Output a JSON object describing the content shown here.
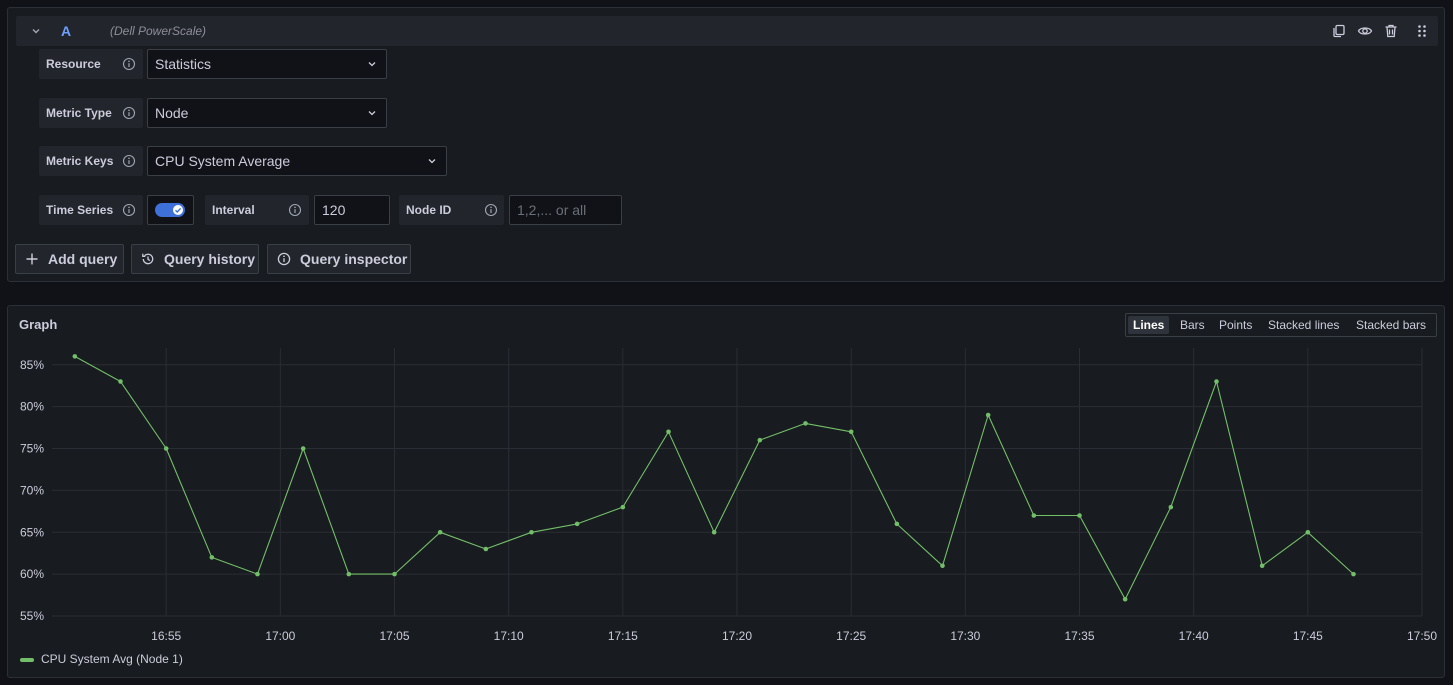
{
  "query": {
    "letter": "A",
    "datasource": "(Dell PowerScale)",
    "header_icons": [
      "collapse-chevron-icon",
      "duplicate-icon",
      "eye-icon",
      "trash-icon",
      "drag-handle-icon"
    ],
    "resource": {
      "label": "Resource",
      "value": "Statistics"
    },
    "metric_type": {
      "label": "Metric Type",
      "value": "Node"
    },
    "metric_keys": {
      "label": "Metric Keys",
      "value": "CPU System Average"
    },
    "time_series": {
      "label": "Time Series",
      "enabled": true
    },
    "interval": {
      "label": "Interval",
      "value": "120"
    },
    "node_id": {
      "label": "Node ID",
      "value": "",
      "placeholder": "1,2,... or all"
    }
  },
  "actions": {
    "add_query": "Add query",
    "query_history": "Query history",
    "query_inspector": "Query inspector"
  },
  "graph": {
    "title": "Graph",
    "view_modes": [
      "Lines",
      "Bars",
      "Points",
      "Stacked lines",
      "Stacked bars"
    ],
    "active_mode": "Lines"
  },
  "chart_data": {
    "type": "line",
    "title": "Graph",
    "xlabel": "",
    "ylabel": "",
    "x_ticks": [
      "16:55",
      "17:00",
      "17:05",
      "17:10",
      "17:15",
      "17:20",
      "17:25",
      "17:30",
      "17:35",
      "17:40",
      "17:45",
      "17:50"
    ],
    "y_ticks": [
      "55%",
      "60%",
      "65%",
      "70%",
      "75%",
      "80%",
      "85%"
    ],
    "ylim": [
      55,
      87
    ],
    "grid": true,
    "legend_position": "bottom-left",
    "series": [
      {
        "name": "CPU System Avg (Node 1)",
        "color": "#73bf69",
        "x": [
          "16:51",
          "16:53",
          "16:55",
          "16:57",
          "16:59",
          "17:01",
          "17:03",
          "17:05",
          "17:07",
          "17:09",
          "17:11",
          "17:13",
          "17:15",
          "17:17",
          "17:19",
          "17:21",
          "17:23",
          "17:25",
          "17:27",
          "17:29",
          "17:31",
          "17:33",
          "17:35",
          "17:37",
          "17:39",
          "17:41",
          "17:43",
          "17:45",
          "17:47"
        ],
        "values": [
          86,
          83,
          75,
          62,
          60,
          75,
          60,
          60,
          65,
          63,
          65,
          66,
          68,
          77,
          65,
          76,
          78,
          77,
          66,
          61,
          79,
          67,
          67,
          57,
          68,
          83,
          61,
          65,
          60
        ]
      }
    ]
  }
}
